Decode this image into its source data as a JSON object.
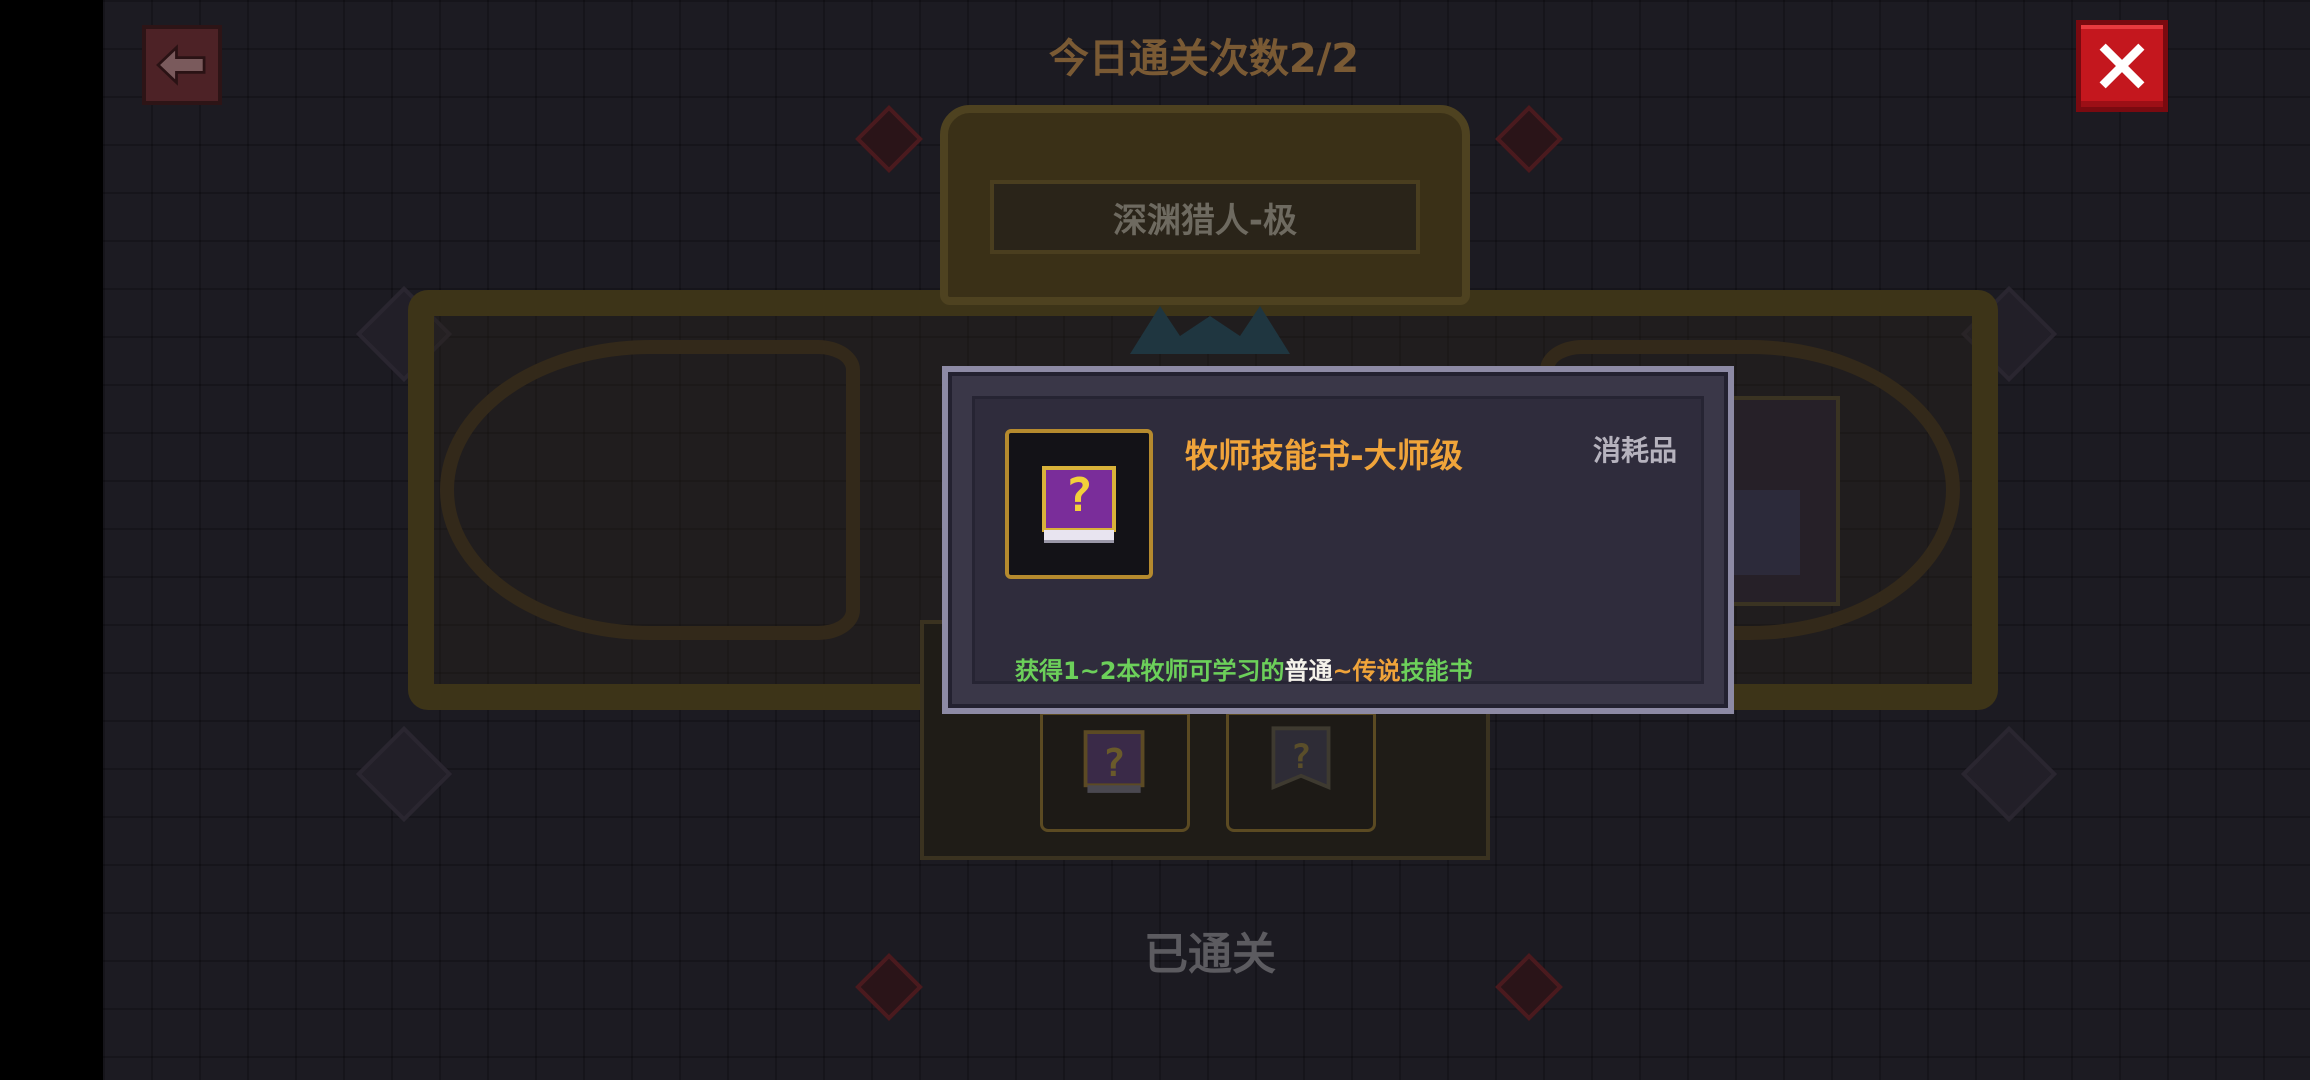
{
  "header": {
    "daily_clear_count": "今日通关次数2/2"
  },
  "level": {
    "name": "深渊猎人-极",
    "status": "已通关"
  },
  "tooltip": {
    "item_name": "牧师技能书-大师级",
    "item_type": "消耗品",
    "description": {
      "part1": "获得1~2本牧师可学习的",
      "part2": "普通",
      "part3": "~",
      "part4": "传说",
      "part5": "技能书"
    }
  },
  "icons": {
    "back": "arrow-left-icon",
    "close": "close-x-icon",
    "item": "mystery-skill-book-icon"
  },
  "colors": {
    "title_orange": "#f0a43a",
    "desc_green": "#6cd05a",
    "close_red": "#c4171e"
  }
}
